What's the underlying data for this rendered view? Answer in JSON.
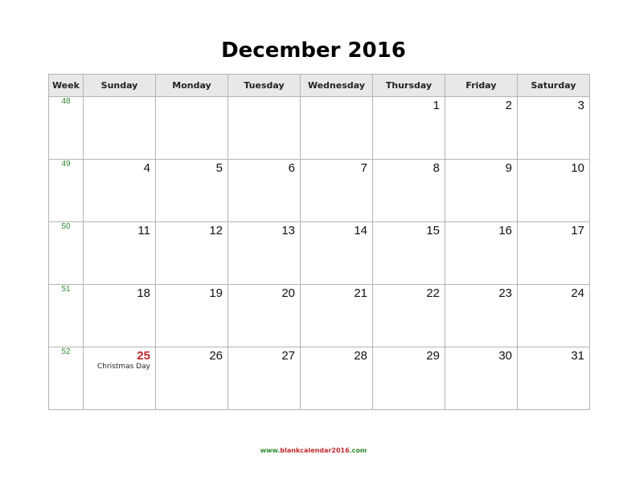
{
  "title": "December 2016",
  "header": {
    "week_label": "Week",
    "days": [
      "Sunday",
      "Monday",
      "Tuesday",
      "Wednesday",
      "Thursday",
      "Friday",
      "Saturday"
    ]
  },
  "weeks": [
    {
      "number": "48",
      "days": [
        "",
        "",
        "",
        "",
        "1",
        "2",
        "3"
      ]
    },
    {
      "number": "49",
      "days": [
        "4",
        "5",
        "6",
        "7",
        "8",
        "9",
        "10"
      ]
    },
    {
      "number": "50",
      "days": [
        "11",
        "12",
        "13",
        "14",
        "15",
        "16",
        "17"
      ]
    },
    {
      "number": "51",
      "days": [
        "18",
        "19",
        "20",
        "21",
        "22",
        "23",
        "24"
      ]
    },
    {
      "number": "52",
      "days": [
        "25",
        "26",
        "27",
        "28",
        "29",
        "30",
        "31"
      ]
    }
  ],
  "holidays": [
    {
      "week": 4,
      "day": 0,
      "name": "Christmas Day"
    }
  ],
  "footer": {
    "prefix": "www.",
    "middle": "blankcalendar2016",
    "suffix": ".com"
  },
  "colors": {
    "holiday": "#c0282d",
    "week_number": "#2e8b2e",
    "header_bg": "#e8e8e8"
  }
}
